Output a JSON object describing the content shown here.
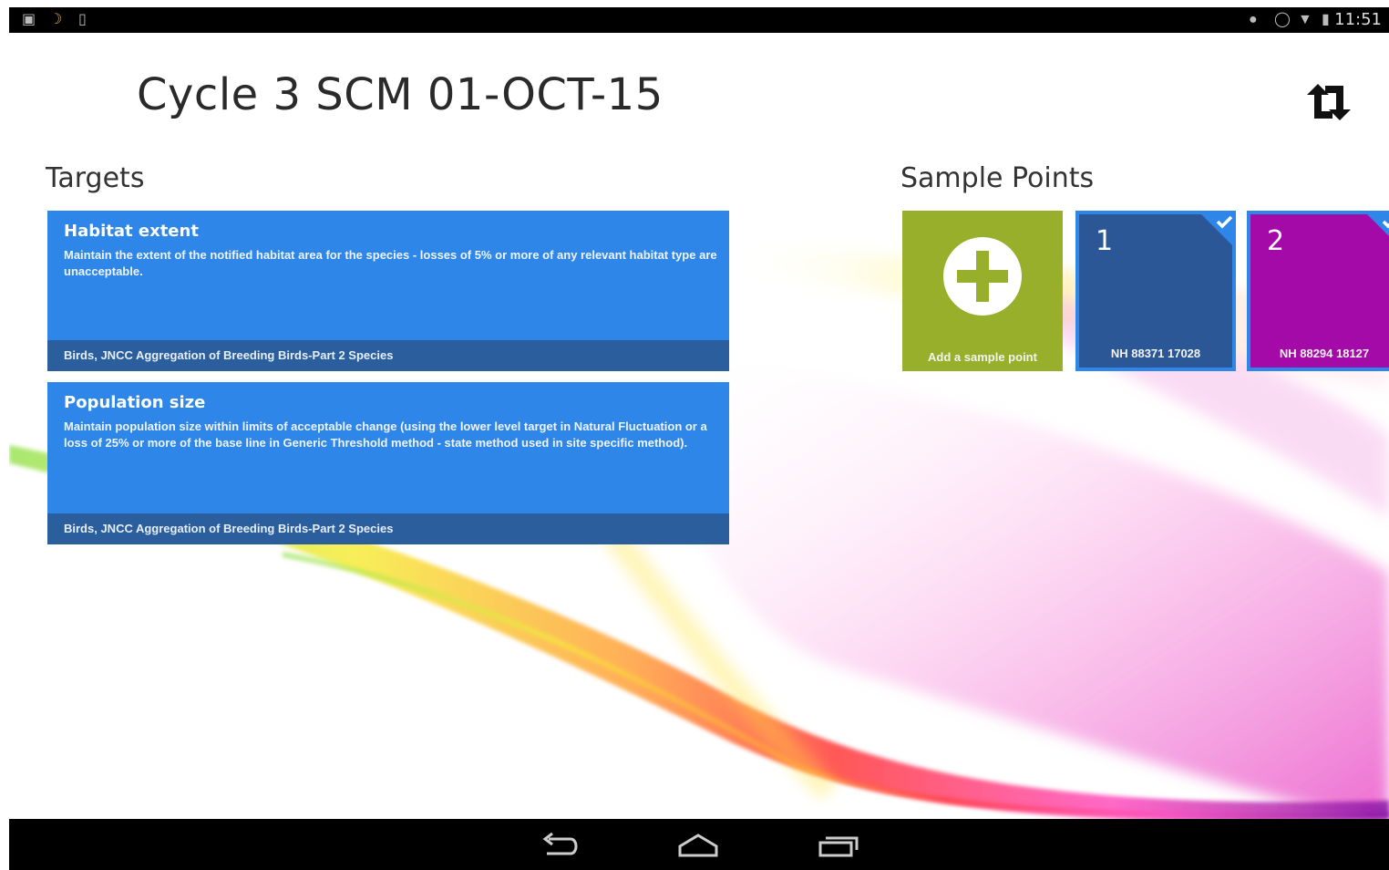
{
  "status_bar": {
    "time": "11:51",
    "left_icons": [
      "picture-icon",
      "moon-icon",
      "battery-outline-icon"
    ],
    "right_icons": [
      "location-pin-icon",
      "alarm-icon",
      "wifi-icon",
      "battery-icon"
    ]
  },
  "header": {
    "title": "Cycle 3 SCM 01-OCT-15",
    "sync_icon": "sync-arrows-icon"
  },
  "targets": {
    "heading": "Targets",
    "items": [
      {
        "title": "Habitat extent",
        "description": "Maintain the extent of the notified habitat area for the species - losses of 5% or more of any relevant habitat type are unacceptable.",
        "footer": "Birds, JNCC Aggregation of Breeding Birds-Part 2 Species"
      },
      {
        "title": "Population size",
        "description": "Maintain population size within limits of acceptable change (using the lower level target in Natural Fluctuation or a loss of 25% or more of the base line in Generic Threshold method - state method used in site specific method).",
        "footer": "Birds, JNCC Aggregation of Breeding Birds-Part 2 Species"
      }
    ]
  },
  "sample_points": {
    "heading": "Sample Points",
    "add_label": "Add a sample point",
    "items": [
      {
        "number": "1",
        "grid_ref": "NH 88371 17028",
        "color": "#2b5797",
        "checked": true
      },
      {
        "number": "2",
        "grid_ref": "NH 88294 18127",
        "color": "#a40aa8",
        "checked": true
      }
    ]
  },
  "colors": {
    "target_card": "#2e86e8",
    "target_footer": "#2b5e9c",
    "add_tile": "#98af2b",
    "selection_border": "#2e86e8"
  },
  "nav_bar": {
    "icons": [
      "back-icon",
      "home-icon",
      "recents-icon"
    ]
  }
}
